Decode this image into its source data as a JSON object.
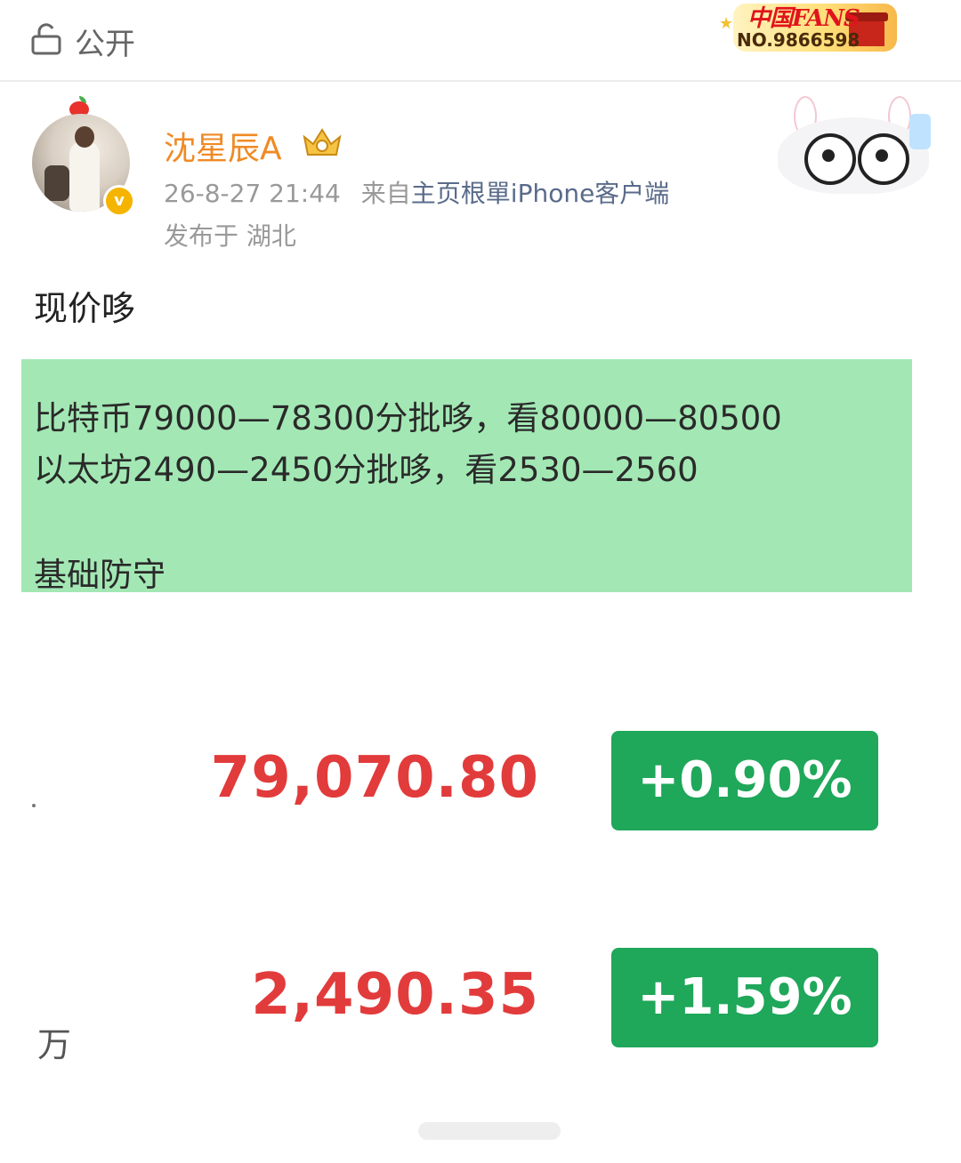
{
  "topbar": {
    "visibility_label": "公开",
    "fans_badge": {
      "title": "中国FANS",
      "number": "NO.9866598"
    }
  },
  "post": {
    "author": {
      "name": "沈星辰A",
      "avatar": "avatar-photo",
      "verified": true
    },
    "meta": {
      "time": "26-8-27 21:44",
      "from_prefix": "来自",
      "source": "主页根單iPhone客户端"
    },
    "location": "发布于 湖北",
    "headline": "现价哆",
    "note": {
      "line1": "比特币79000—78300分批哆，看80000—80500",
      "line2": "以太坊2490—2450分批哆，看2530—2560",
      "line3": "基础防守"
    }
  },
  "quotes": [
    {
      "price": "79,070.80",
      "change": "+0.90%"
    },
    {
      "price": "2,490.35",
      "change": "+1.59%"
    }
  ],
  "unit_label": "万",
  "colors": {
    "up": "#1fa75a",
    "price": "#e23b3b",
    "name": "#f08a24",
    "note_bg": "#a3e8b4"
  }
}
